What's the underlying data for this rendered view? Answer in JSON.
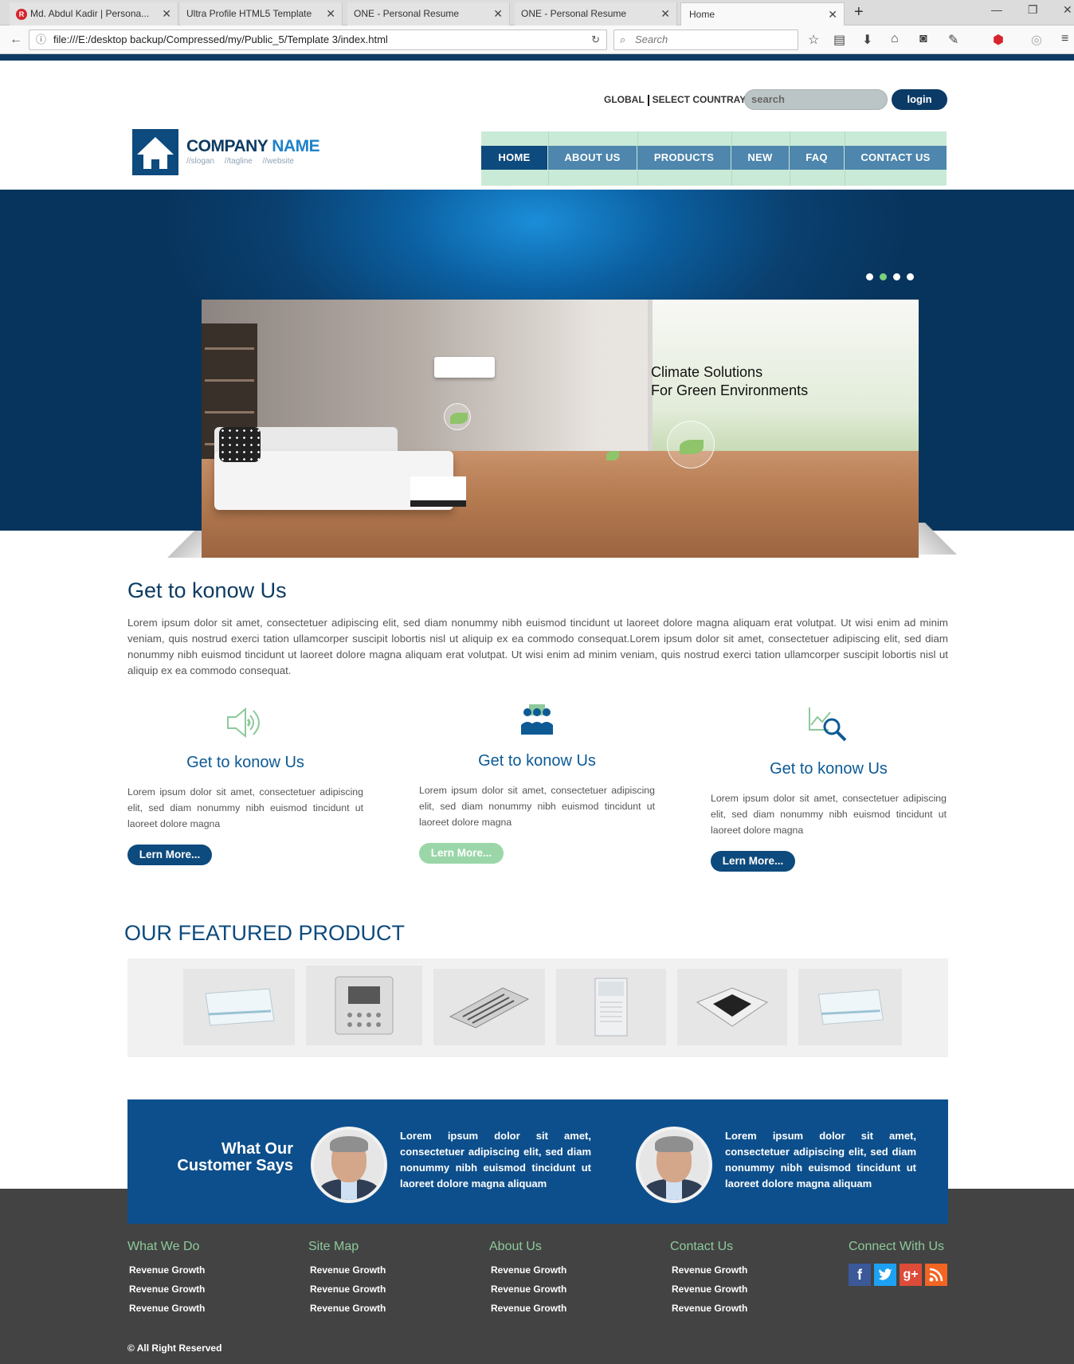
{
  "browser": {
    "tabs": [
      {
        "title": "Md. Abdul Kadir | Persona..."
      },
      {
        "title": "Ultra Profile HTML5 Template"
      },
      {
        "title": "ONE - Personal Resume"
      },
      {
        "title": "ONE - Personal Resume"
      },
      {
        "title": "Home"
      }
    ],
    "url": "file:///E:/desktop backup/Compressed/my/Public_5/Template 3/index.html",
    "search_placeholder": "Search"
  },
  "header": {
    "global_label": "GLOBAL",
    "country_label": "SELECT COUNTRAY",
    "search_placeholder": "search",
    "login_label": "login",
    "logo": {
      "name_part1": "COMPANY",
      "name_part2": "NAME",
      "tagline": "//slogan //tagline //website"
    },
    "nav": [
      "HOME",
      "ABOUT US",
      "PRODUCTS",
      "NEW",
      "FAQ",
      "CONTACT US"
    ]
  },
  "hero": {
    "caption_line1": "Climate Solutions",
    "caption_line2": "For Green Environments",
    "slides_count": 4,
    "active_slide": 2
  },
  "about": {
    "title": "Get to konow Us",
    "text": "Lorem ipsum dolor sit amet, consectetuer adipiscing elit, sed diam nonummy nibh euismod tincidunt ut laoreet dolore magna aliquam erat volutpat. Ut wisi enim ad minim veniam, quis nostrud exerci tation ullamcorper suscipit lobortis nisl ut aliquip ex ea commodo consequat.Lorem ipsum dolor sit amet, consectetuer adipiscing elit, sed diam nonummy nibh euismod tincidunt ut laoreet dolore magna aliquam erat volutpat. Ut wisi enim ad minim veniam, quis nostrud exerci tation ullamcorper suscipit lobortis nisl ut aliquip ex ea commodo consequat."
  },
  "features": [
    {
      "icon": "speaker-icon",
      "title": "Get to konow Us",
      "text": "Lorem ipsum dolor sit amet, consectetuer adipiscing elit, sed diam nonummy nibh euismod tincidunt ut laoreet dolore magna",
      "button": "Lern More..."
    },
    {
      "icon": "team-icon",
      "title": "Get to konow Us",
      "text": "Lorem ipsum dolor sit amet, consectetuer adipiscing elit, sed diam nonummy nibh euismod tincidunt ut laoreet dolore magna",
      "button": "Lern More..."
    },
    {
      "icon": "chart-search-icon",
      "title": "Get to konow Us",
      "text": "Lorem ipsum dolor sit amet, consectetuer adipiscing elit, sed diam nonummy nibh euismod tincidunt ut laoreet dolore magna",
      "button": "Lern More..."
    }
  ],
  "featured": {
    "title": "OUR FEATURED PRODUCT",
    "products": [
      "fan-coil-unit-icon",
      "thermostat-panel-icon",
      "ceiling-diffuser-icon",
      "outdoor-unit-icon",
      "cassette-unit-icon",
      "fan-coil-unit-icon"
    ]
  },
  "testimonials": {
    "title_line1": "What Our",
    "title_line2": "Customer Says",
    "items": [
      {
        "text": "Lorem ipsum dolor sit amet, consectetuer adipiscing elit, sed diam nonummy nibh euismod tincidunt ut laoreet dolore magna aliquam"
      },
      {
        "text": "Lorem ipsum dolor sit amet, consectetuer adipiscing elit, sed diam nonummy nibh euismod tincidunt ut laoreet dolore magna aliquam"
      }
    ]
  },
  "footer": {
    "columns": [
      {
        "heading": "What We Do",
        "links": [
          "Revenue Growth",
          "Revenue Growth",
          "Revenue Growth"
        ]
      },
      {
        "heading": "Site Map",
        "links": [
          "Revenue Growth",
          "Revenue Growth",
          "Revenue Growth"
        ]
      },
      {
        "heading": "About Us",
        "links": [
          "Revenue Growth",
          "Revenue Growth",
          "Revenue Growth"
        ]
      },
      {
        "heading": "Contact Us",
        "links": [
          "Revenue Growth",
          "Revenue Growth",
          "Revenue Growth"
        ]
      }
    ],
    "connect_heading": "Connect With Us",
    "social": [
      {
        "icon": "facebook-icon",
        "glyph": "f",
        "color": "#3b5998"
      },
      {
        "icon": "twitter-icon",
        "glyph": "t",
        "color": "#1da1f2"
      },
      {
        "icon": "google-plus-icon",
        "glyph": "g+",
        "color": "#dd4b39"
      },
      {
        "icon": "rss-icon",
        "glyph": "rss",
        "color": "#f26522"
      }
    ],
    "copyright": "© All Right Reserved"
  },
  "colors": {
    "brand_dark": "#0d3b63",
    "brand": "#0d4a7d",
    "accent_green": "#8dc99b",
    "footer_bg": "#434343"
  }
}
